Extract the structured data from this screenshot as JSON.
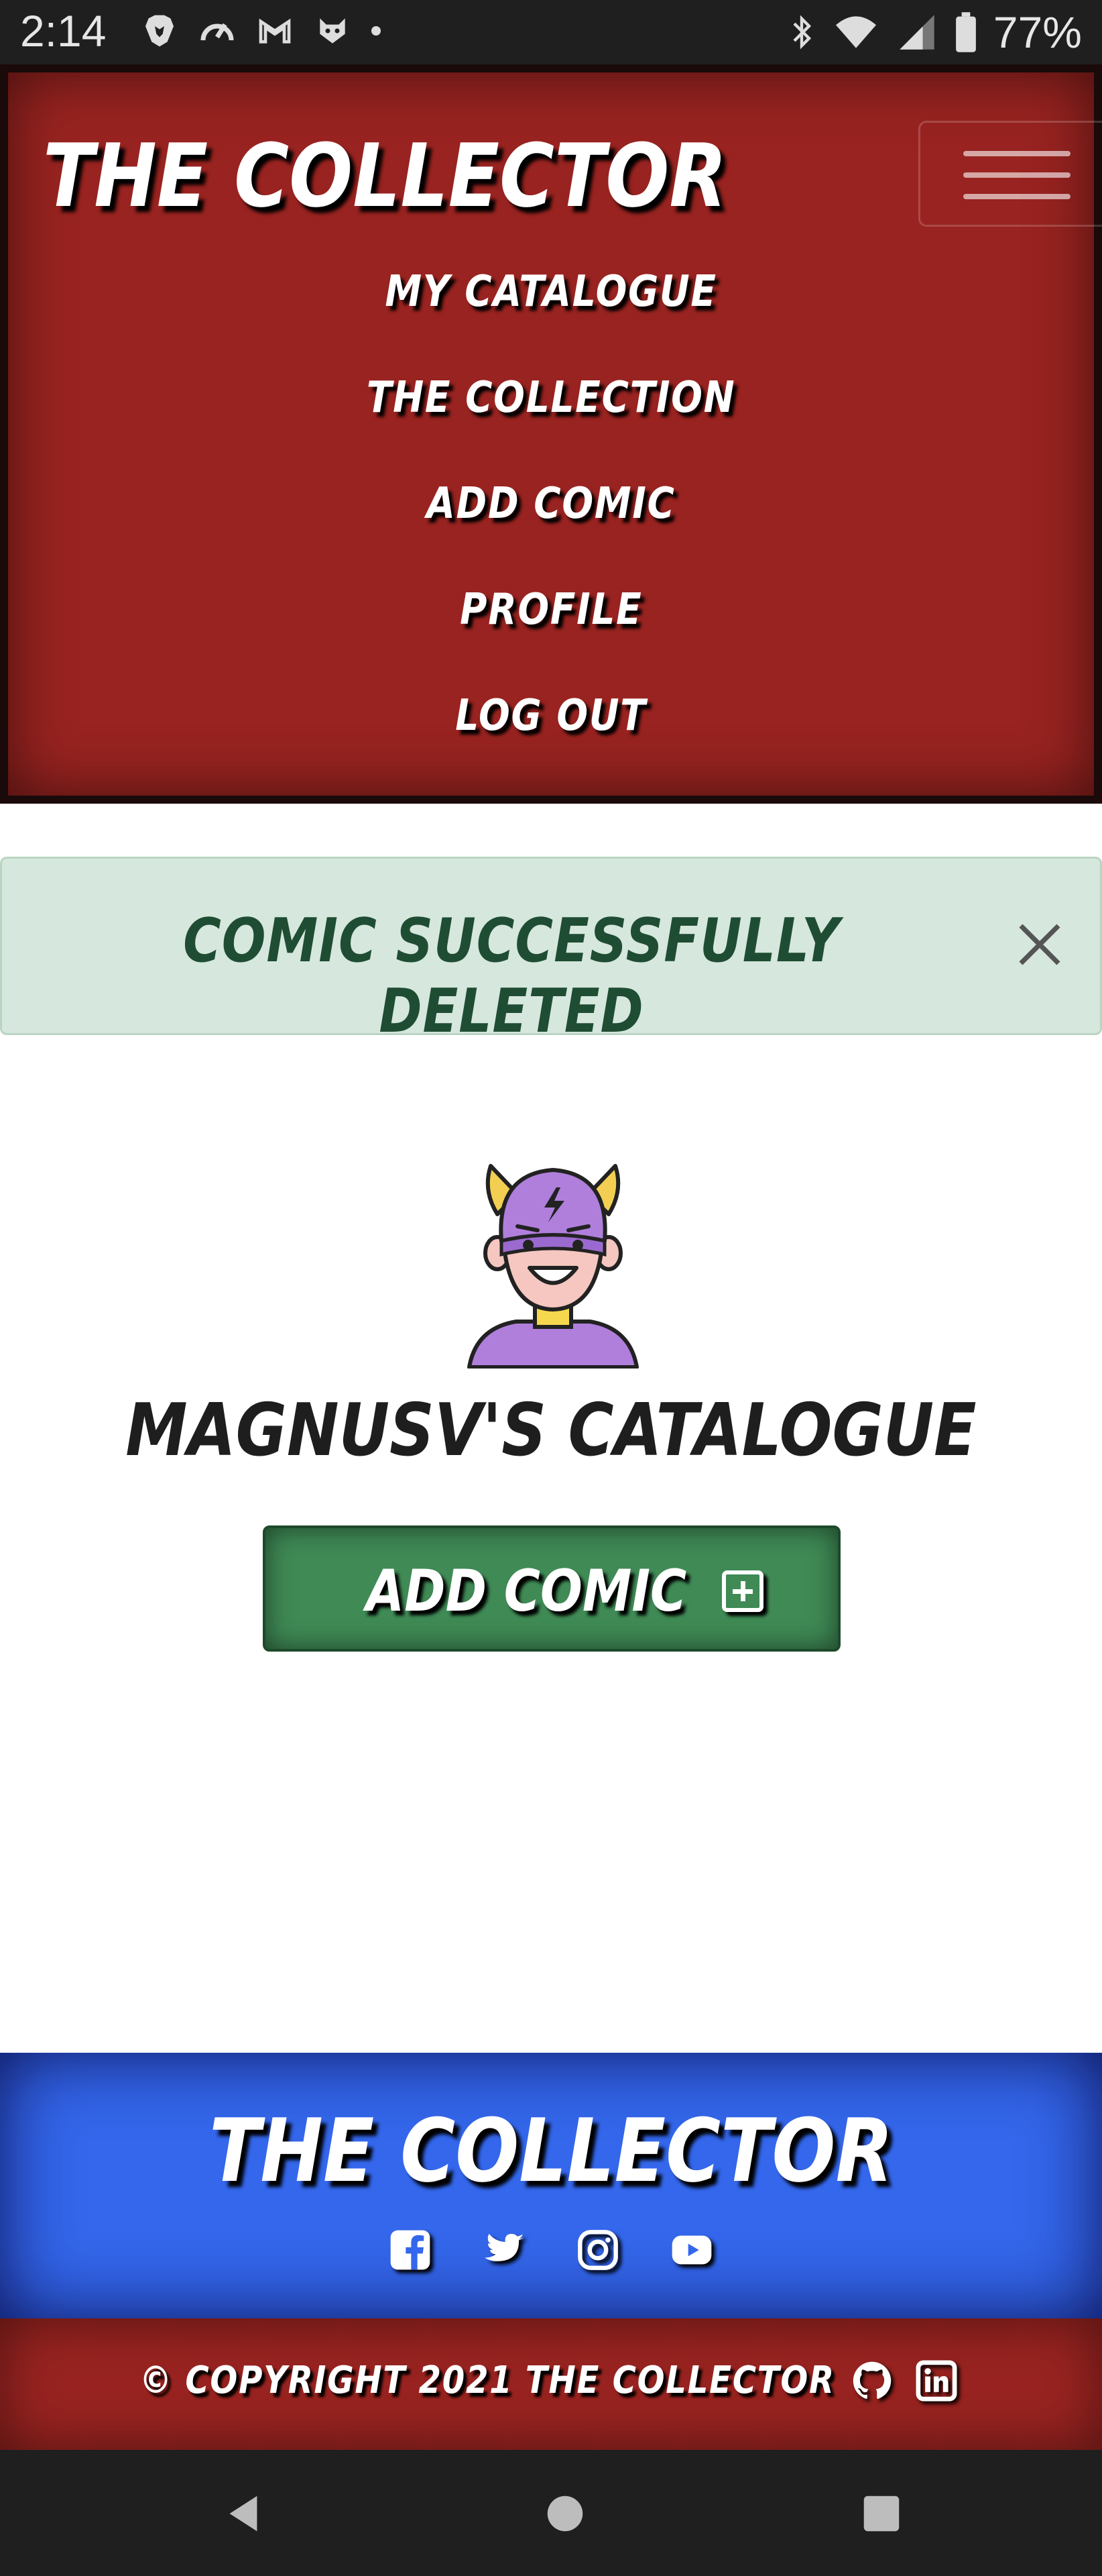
{
  "status_bar": {
    "time": "2:14",
    "battery": "77%",
    "icons_left": [
      "brave-icon",
      "speed-icon",
      "gmail-icon",
      "cat-icon",
      "notification-dot"
    ],
    "icons_right": [
      "bluetooth-icon",
      "wifi-icon",
      "signal-icon",
      "battery-icon"
    ]
  },
  "navbar": {
    "brand": "THE COLLECTOR",
    "menu_icon": "hamburger-icon",
    "links": [
      "MY CATALOGUE",
      "THE COLLECTION",
      "ADD COMIC",
      "PROFILE",
      "LOG OUT"
    ]
  },
  "alert": {
    "message": "COMIC SUCCESSFULLY DELETED",
    "close_icon": "close-icon"
  },
  "main": {
    "avatar_icon": "superhero-avatar",
    "title": "MAGNUSV'S CATALOGUE",
    "add_button": "ADD COMIC"
  },
  "footer": {
    "brand": "THE COLLECTOR",
    "social_icons": [
      "facebook-icon",
      "twitter-icon",
      "instagram-icon",
      "youtube-icon"
    ],
    "copyright": "© COPYRIGHT 2021 THE COLLECTOR",
    "dev_icons": [
      "github-icon",
      "linkedin-icon"
    ]
  },
  "colors": {
    "nav_red": "#982320",
    "footer_blue": "#3467ec",
    "alert_bg": "#d6e7dd",
    "alert_text": "#1f4d33",
    "button_green": "#3f8a55"
  }
}
